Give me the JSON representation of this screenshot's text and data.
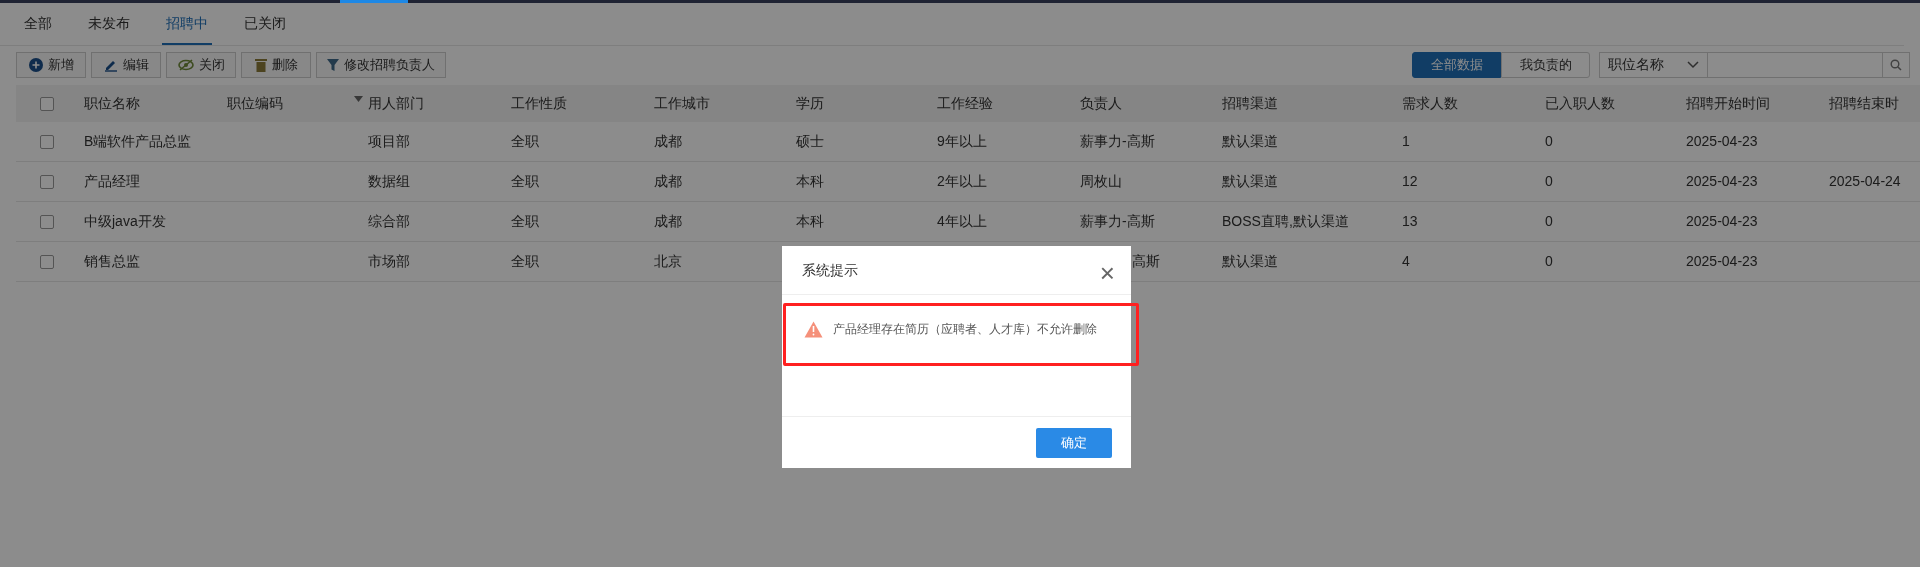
{
  "tabs": [
    {
      "label": "全部",
      "selected": false
    },
    {
      "label": "未发布",
      "selected": false
    },
    {
      "label": "招聘中",
      "selected": true
    },
    {
      "label": "已关闭",
      "selected": false
    }
  ],
  "toolbar": [
    {
      "label": "新增",
      "kind": "add"
    },
    {
      "label": "编辑",
      "kind": "edit"
    },
    {
      "label": "关闭",
      "kind": "hide"
    },
    {
      "label": "删除",
      "kind": "delete"
    },
    {
      "label": "修改招聘负责人",
      "kind": "filter"
    }
  ],
  "scope_toggle": [
    {
      "label": "全部数据",
      "selected": true
    },
    {
      "label": "我负责的",
      "selected": false
    }
  ],
  "search": {
    "field": "职位名称"
  },
  "table": {
    "all_checked": false,
    "columns": [
      {
        "label": "职位名称",
        "sorted": false
      },
      {
        "label": "职位编码",
        "sorted": false
      },
      {
        "label": "用人部门",
        "sorted": true
      },
      {
        "label": "工作性质",
        "sorted": false
      },
      {
        "label": "工作城市",
        "sorted": false
      },
      {
        "label": "学历",
        "sorted": false
      },
      {
        "label": "工作经验",
        "sorted": false
      },
      {
        "label": "负责人",
        "sorted": false
      },
      {
        "label": "招聘渠道",
        "sorted": false
      },
      {
        "label": "需求人数",
        "sorted": false
      },
      {
        "label": "已入职人数",
        "sorted": false
      },
      {
        "label": "招聘开始时间",
        "sorted": false
      },
      {
        "label": "招聘结束时",
        "sorted": false
      }
    ],
    "rows": [
      {
        "checked": false,
        "cells": [
          "B端软件产品总监",
          null,
          "项目部",
          "全职",
          "成都",
          "硕士",
          "9年以上",
          "薪事力-高斯",
          "默认渠道",
          "1",
          "0",
          "2025-04-23",
          null
        ]
      },
      {
        "checked": false,
        "cells": [
          "产品经理",
          null,
          "数据组",
          "全职",
          "成都",
          "本科",
          "2年以上",
          "周枚山",
          "默认渠道",
          "12",
          "0",
          "2025-04-23",
          "2025-04-24"
        ]
      },
      {
        "checked": false,
        "cells": [
          "中级java开发",
          null,
          "综合部",
          "全职",
          "成都",
          "本科",
          "4年以上",
          "薪事力-高斯",
          "BOSS直聘,默认渠道",
          "13",
          "0",
          "2025-04-23",
          null
        ]
      },
      {
        "checked": false,
        "cells": [
          "销售总监",
          null,
          "市场部",
          "全职",
          "北京",
          null,
          null,
          "高斯",
          "默认渠道",
          "4",
          "0",
          "2025-04-23",
          null
        ]
      }
    ]
  },
  "dialog": {
    "title": "系统提示",
    "close": "×",
    "message": "产品经理存在简历（应聘者、人才库）不允许删除",
    "highlighted": true,
    "confirm": "确定"
  }
}
